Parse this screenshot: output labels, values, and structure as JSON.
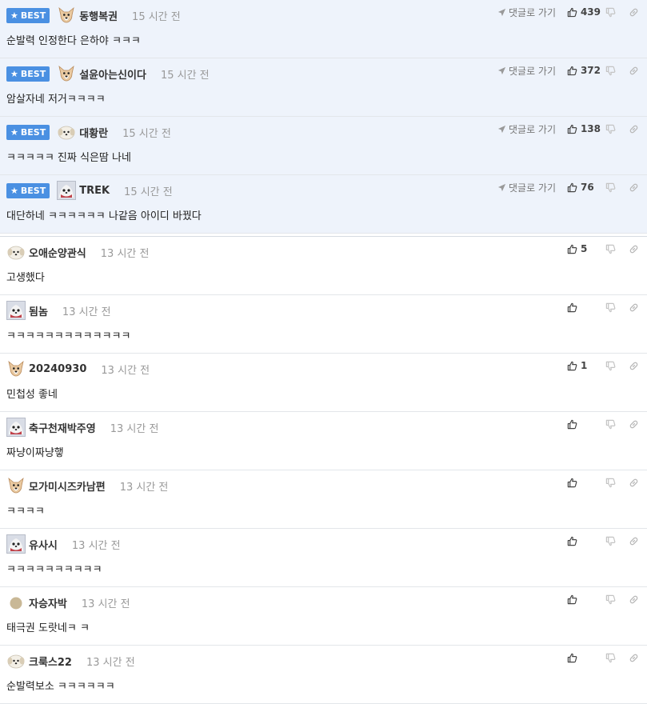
{
  "best_badge": "BEST",
  "goto_label": "댓글로 가기",
  "best_comments": [
    {
      "nick": "동행복권",
      "time": "15 시간 전",
      "text": "순발력 인정한다 은하야 ㅋㅋㅋ",
      "likes": "439",
      "avatar": "dog-avatar"
    },
    {
      "nick": "설윤아는신이다",
      "time": "15 시간 전",
      "text": "암살자네 저거ㅋㅋㅋㅋ",
      "likes": "372",
      "avatar": "dog-avatar"
    },
    {
      "nick": "대황란",
      "time": "15 시간 전",
      "text": "ㅋㅋㅋㅋㅋ 진짜 식은땀 나네",
      "likes": "138",
      "avatar": "puppy-avatar"
    },
    {
      "nick": "TREK",
      "time": "15 시간 전",
      "text": "대단하네 ㅋㅋㅋㅋㅋㅋ 나같음 아이디 바꿨다",
      "likes": "76",
      "avatar": "photo-avatar"
    }
  ],
  "comments": [
    {
      "nick": "오애순양관식",
      "time": "13 시간 전",
      "text": "고생했다",
      "likes": "5",
      "avatar": "puppy-avatar"
    },
    {
      "nick": "됨놈",
      "time": "13 시간 전",
      "text": "ㅋㅋㅋㅋㅋㅋㅋㅋㅋㅋㅋㅋㅋ",
      "likes": "",
      "avatar": "photo-avatar"
    },
    {
      "nick": "20240930",
      "time": "13 시간 전",
      "text": "민첩성 좋네",
      "likes": "1",
      "avatar": "dog-avatar"
    },
    {
      "nick": "축구천재박주영",
      "time": "13 시간 전",
      "text": "짜냥이짜냥햏",
      "likes": "",
      "avatar": "photo-avatar"
    },
    {
      "nick": "모가미시즈카남편",
      "time": "13 시간 전",
      "text": "ㅋㅋㅋㅋ",
      "likes": "",
      "avatar": "dog-avatar"
    },
    {
      "nick": "유사시",
      "time": "13 시간 전",
      "text": "ㅋㅋㅋㅋㅋㅋㅋㅋㅋㅋ",
      "likes": "",
      "avatar": "photo-avatar"
    },
    {
      "nick": "자승자박",
      "time": "13 시간 전",
      "text": "태극권 도랏네ㅋ ㅋ",
      "likes": "",
      "avatar": "circle-avatar"
    },
    {
      "nick": "크룩스22",
      "time": "13 시간 전",
      "text": "순발력보소 ㅋㅋㅋㅋㅋㅋ",
      "likes": "",
      "avatar": "puppy-avatar"
    }
  ]
}
